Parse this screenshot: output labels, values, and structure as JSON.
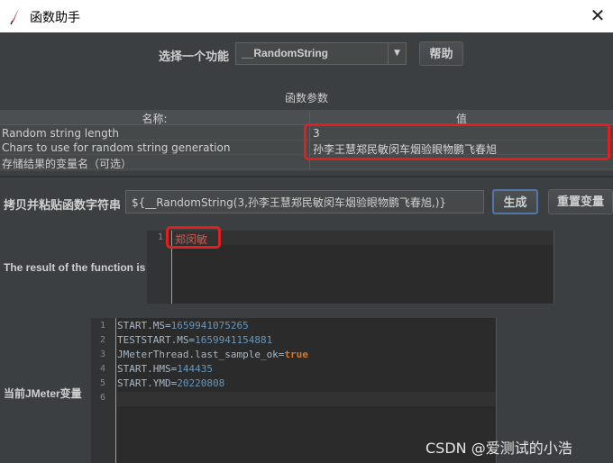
{
  "window": {
    "title": "函数助手",
    "close_glyph": "✕"
  },
  "function_select": {
    "label": "选择一个功能",
    "value": "__RandomString",
    "arrow": "▼"
  },
  "help_button": "帮助",
  "params": {
    "section_title": "函数参数",
    "col_name": "名称:",
    "col_value": "值",
    "rows": [
      {
        "name": "Random string length",
        "value": "3"
      },
      {
        "name": "Chars to use for random string generation",
        "value": "孙李王慧郑民敏闵车烟验眼物鹏飞春旭"
      },
      {
        "name": "存储结果的变量名（可选）",
        "value": ""
      }
    ]
  },
  "copy": {
    "label": "拷贝并粘贴函数字符串",
    "value": "${__RandomString(3,孙李王慧郑民敏闵车烟验眼物鹏飞春旭,)}",
    "generate_button": "生成",
    "reset_button": "重置变量"
  },
  "result": {
    "label": "The result of the function is",
    "line_number": "1",
    "value": "郑闵敏"
  },
  "jmeter_vars": {
    "label": "当前JMeter变量",
    "lines": [
      {
        "num": "1",
        "key": "START.MS=",
        "val": "1659941075265"
      },
      {
        "num": "2",
        "key": "TESTSTART.MS=",
        "val": "1659941154881"
      },
      {
        "num": "3",
        "key": "JMeterThread.last_sample_ok=",
        "val": "true"
      },
      {
        "num": "4",
        "key": "START.HMS=",
        "val": "144435"
      },
      {
        "num": "5",
        "key": "START.YMD=",
        "val": "20220808"
      },
      {
        "num": "6",
        "key": "",
        "val": ""
      }
    ]
  },
  "watermark": "CSDN @爱测试的小浩",
  "colors": {
    "highlight": "#e02020",
    "background": "#3c3f41",
    "editor": "#2b2b2b"
  }
}
